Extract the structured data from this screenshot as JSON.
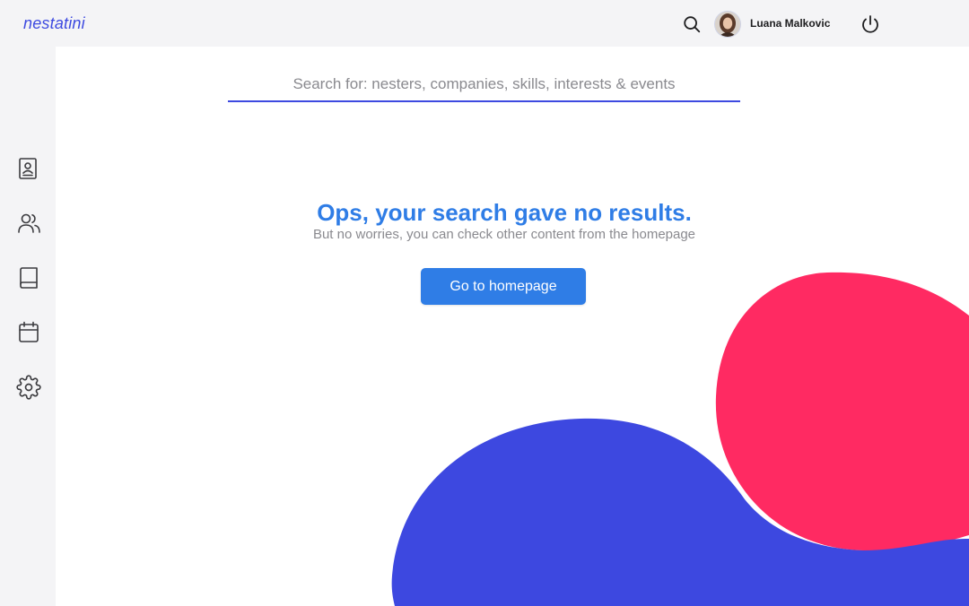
{
  "app": {
    "logo": "nestatini"
  },
  "header": {
    "user_name": "Luana Malkovic"
  },
  "sidebar": {
    "items": [
      {
        "icon": "contact-book-icon"
      },
      {
        "icon": "users-icon"
      },
      {
        "icon": "book-icon"
      },
      {
        "icon": "calendar-icon"
      },
      {
        "icon": "gear-icon"
      }
    ]
  },
  "search": {
    "placeholder": "Search for: nesters, companies, skills, interests & events",
    "value": ""
  },
  "empty_state": {
    "title": "Ops, your search gave no results.",
    "subtitle": "But no worries, you can check other content from the homepage",
    "button_label": "Go to homepage"
  },
  "colors": {
    "accent_blue": "#2f7de6",
    "brand_indigo": "#3d4ae0",
    "blob_pink": "#ff2a62",
    "blob_indigo": "#3d48e0"
  }
}
